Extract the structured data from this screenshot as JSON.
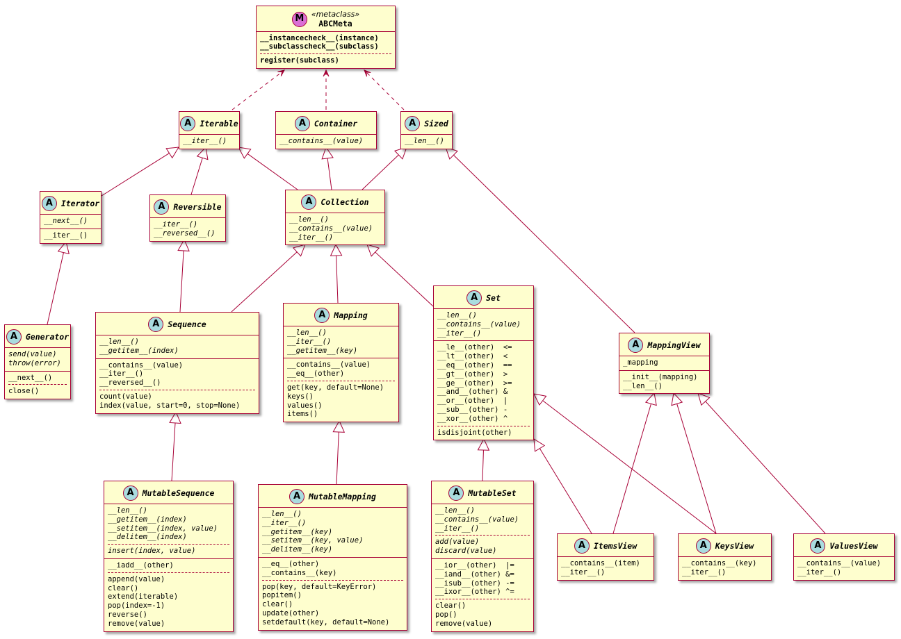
{
  "diagram": {
    "classes": [
      {
        "id": "abcmeta",
        "name": "ABCMeta",
        "badge": "M",
        "stereotype": "«metaclass»",
        "compartments": [
          [
            [
              {
                "t": "__instancecheck__(instance)"
              },
              {
                "t": "__subclasscheck__(subclass)"
              }
            ],
            [
              {
                "t": "register(subclass)"
              }
            ]
          ]
        ]
      },
      {
        "id": "iterable",
        "name": "Iterable",
        "badge": "A",
        "compartments": [
          [
            [
              {
                "t": "__iter__()",
                "a": 1
              }
            ]
          ]
        ]
      },
      {
        "id": "container",
        "name": "Container",
        "badge": "A",
        "compartments": [
          [
            [
              {
                "t": "__contains__(value)",
                "a": 1
              }
            ]
          ]
        ]
      },
      {
        "id": "sized",
        "name": "Sized",
        "badge": "A",
        "compartments": [
          [
            [
              {
                "t": "__len__()",
                "a": 1
              }
            ]
          ]
        ]
      },
      {
        "id": "iterator",
        "name": "Iterator",
        "badge": "A",
        "compartments": [
          [
            [
              {
                "t": "__next__()",
                "a": 1
              }
            ]
          ],
          [
            [
              {
                "t": "__iter__()"
              }
            ]
          ]
        ]
      },
      {
        "id": "reversible",
        "name": "Reversible",
        "badge": "A",
        "compartments": [
          [
            [
              {
                "t": "__iter__()",
                "a": 1
              },
              {
                "t": "__reversed__()",
                "a": 1
              }
            ]
          ]
        ]
      },
      {
        "id": "collection",
        "name": "Collection",
        "badge": "A",
        "compartments": [
          [
            [
              {
                "t": "__len__()",
                "a": 1
              },
              {
                "t": "__contains__(value)",
                "a": 1
              },
              {
                "t": "__iter__()",
                "a": 1
              }
            ]
          ]
        ]
      },
      {
        "id": "generator",
        "name": "Generator",
        "badge": "A",
        "compartments": [
          [
            [
              {
                "t": "send(value)",
                "a": 1
              },
              {
                "t": "throw(error)",
                "a": 1
              }
            ]
          ],
          [
            [
              {
                "t": "__next__()"
              }
            ],
            [
              {
                "t": "close()"
              }
            ]
          ]
        ]
      },
      {
        "id": "sequence",
        "name": "Sequence",
        "badge": "A",
        "compartments": [
          [
            [
              {
                "t": "__len__()",
                "a": 1
              },
              {
                "t": "__getitem__(index)",
                "a": 1
              }
            ]
          ],
          [
            [
              {
                "t": "__contains__(value)"
              },
              {
                "t": "__iter__()"
              },
              {
                "t": "__reversed__()"
              }
            ],
            [
              {
                "t": "count(value)"
              },
              {
                "t": "index(value, start=0, stop=None)"
              }
            ]
          ]
        ]
      },
      {
        "id": "mapping",
        "name": "Mapping",
        "badge": "A",
        "compartments": [
          [
            [
              {
                "t": "__len__()",
                "a": 1
              },
              {
                "t": "__iter__()",
                "a": 1
              },
              {
                "t": "__getitem__(key)",
                "a": 1
              }
            ]
          ],
          [
            [
              {
                "t": "__contains__(value)"
              },
              {
                "t": "__eq__(other)"
              }
            ],
            [
              {
                "t": "get(key, default=None)"
              },
              {
                "t": "keys()"
              },
              {
                "t": "values()"
              },
              {
                "t": "items()"
              }
            ]
          ]
        ]
      },
      {
        "id": "set",
        "name": "Set",
        "badge": "A",
        "compartments": [
          [
            [
              {
                "t": "__len__()",
                "a": 1
              },
              {
                "t": "__contains__(value)",
                "a": 1
              },
              {
                "t": "__iter__()",
                "a": 1
              }
            ]
          ],
          [
            [
              {
                "t": "__le__(other)  <="
              },
              {
                "t": "__lt__(other)  <"
              },
              {
                "t": "__eq__(other)  =="
              },
              {
                "t": "__gt__(other)  >"
              },
              {
                "t": "__ge__(other)  >="
              },
              {
                "t": "__and__(other) &"
              },
              {
                "t": "__or__(other)  |"
              },
              {
                "t": "__sub__(other) -"
              },
              {
                "t": "__xor__(other) ^"
              }
            ],
            [
              {
                "t": "isdisjoint(other)"
              }
            ]
          ]
        ]
      },
      {
        "id": "mappingview",
        "name": "MappingView",
        "badge": "A",
        "compartments": [
          [
            [
              {
                "t": "_mapping"
              }
            ]
          ],
          [
            [
              {
                "t": "__init__(mapping)"
              },
              {
                "t": "__len__()"
              }
            ]
          ]
        ]
      },
      {
        "id": "mutablesequence",
        "name": "MutableSequence",
        "badge": "A",
        "compartments": [
          [
            [
              {
                "t": "__len__()",
                "a": 1
              },
              {
                "t": "__getitem__(index)",
                "a": 1
              },
              {
                "t": "__setitem__(index, value)",
                "a": 1
              },
              {
                "t": "__delitem__(index)",
                "a": 1
              }
            ],
            [
              {
                "t": "insert(index, value)",
                "a": 1
              }
            ]
          ],
          [
            [
              {
                "t": "__iadd__(other)"
              }
            ],
            [
              {
                "t": "append(value)"
              },
              {
                "t": "clear()"
              },
              {
                "t": "extend(iterable)"
              },
              {
                "t": "pop(index=-1)"
              },
              {
                "t": "reverse()"
              },
              {
                "t": "remove(value)"
              }
            ]
          ]
        ]
      },
      {
        "id": "mutablemapping",
        "name": "MutableMapping",
        "badge": "A",
        "compartments": [
          [
            [
              {
                "t": "__len__()",
                "a": 1
              },
              {
                "t": "__iter__()",
                "a": 1
              },
              {
                "t": "__getitem__(key)",
                "a": 1
              },
              {
                "t": "__setitem__(key, value)",
                "a": 1
              },
              {
                "t": "__delitem__(key)",
                "a": 1
              }
            ]
          ],
          [
            [
              {
                "t": "__eq__(other)"
              },
              {
                "t": "__contains__(key)"
              }
            ],
            [
              {
                "t": "pop(key, default=KeyError)"
              },
              {
                "t": "popitem()"
              },
              {
                "t": "clear()"
              },
              {
                "t": "update(other)"
              },
              {
                "t": "setdefault(key, default=None)"
              }
            ]
          ]
        ]
      },
      {
        "id": "mutableset",
        "name": "MutableSet",
        "badge": "A",
        "compartments": [
          [
            [
              {
                "t": "__len__()",
                "a": 1
              },
              {
                "t": "__contains__(value)",
                "a": 1
              },
              {
                "t": "__iter__()",
                "a": 1
              }
            ],
            [
              {
                "t": "add(value)",
                "a": 1
              },
              {
                "t": "discard(value)",
                "a": 1
              }
            ]
          ],
          [
            [
              {
                "t": "__ior__(other)  |="
              },
              {
                "t": "__iand__(other) &="
              },
              {
                "t": "__isub__(other) -="
              },
              {
                "t": "__ixor__(other) ^="
              }
            ],
            [
              {
                "t": "clear()"
              },
              {
                "t": "pop()"
              },
              {
                "t": "remove(value)"
              }
            ]
          ]
        ]
      },
      {
        "id": "itemsview",
        "name": "ItemsView",
        "badge": "A",
        "compartments": [
          [
            [
              {
                "t": "__contains__(item)"
              },
              {
                "t": "__iter__()"
              }
            ]
          ]
        ]
      },
      {
        "id": "keysview",
        "name": "KeysView",
        "badge": "A",
        "compartments": [
          [
            [
              {
                "t": "__contains__(key)"
              },
              {
                "t": "__iter__()"
              }
            ]
          ]
        ]
      },
      {
        "id": "valuesview",
        "name": "ValuesView",
        "badge": "A",
        "compartments": [
          [
            [
              {
                "t": "__contains__(value)"
              },
              {
                "t": "__iter__()"
              }
            ]
          ]
        ]
      }
    ],
    "relations": [
      {
        "from": "iterable",
        "to": "abcmeta",
        "kind": "dependency"
      },
      {
        "from": "container",
        "to": "abcmeta",
        "kind": "dependency"
      },
      {
        "from": "sized",
        "to": "abcmeta",
        "kind": "dependency"
      },
      {
        "from": "iterator",
        "to": "iterable",
        "kind": "inheritance"
      },
      {
        "from": "reversible",
        "to": "iterable",
        "kind": "inheritance"
      },
      {
        "from": "collection",
        "to": "iterable",
        "kind": "inheritance"
      },
      {
        "from": "collection",
        "to": "container",
        "kind": "inheritance"
      },
      {
        "from": "collection",
        "to": "sized",
        "kind": "inheritance"
      },
      {
        "from": "mappingview",
        "to": "sized",
        "kind": "inheritance"
      },
      {
        "from": "generator",
        "to": "iterator",
        "kind": "inheritance"
      },
      {
        "from": "sequence",
        "to": "reversible",
        "kind": "inheritance"
      },
      {
        "from": "sequence",
        "to": "collection",
        "kind": "inheritance"
      },
      {
        "from": "mapping",
        "to": "collection",
        "kind": "inheritance"
      },
      {
        "from": "set",
        "to": "collection",
        "kind": "inheritance"
      },
      {
        "from": "mutablesequence",
        "to": "sequence",
        "kind": "inheritance"
      },
      {
        "from": "mutablemapping",
        "to": "mapping",
        "kind": "inheritance"
      },
      {
        "from": "mutableset",
        "to": "set",
        "kind": "inheritance"
      },
      {
        "from": "itemsview",
        "to": "set",
        "kind": "inheritance"
      },
      {
        "from": "keysview",
        "to": "set",
        "kind": "inheritance"
      },
      {
        "from": "itemsview",
        "to": "mappingview",
        "kind": "inheritance"
      },
      {
        "from": "keysview",
        "to": "mappingview",
        "kind": "inheritance"
      },
      {
        "from": "valuesview",
        "to": "mappingview",
        "kind": "inheritance"
      }
    ]
  }
}
